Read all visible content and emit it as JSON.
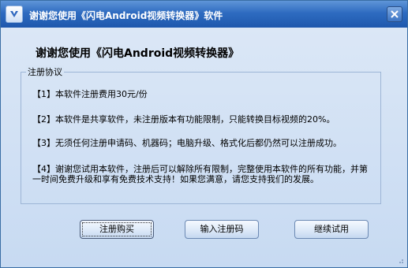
{
  "window": {
    "title": "谢谢您使用《闪电Android视频转换器》软件"
  },
  "dialog": {
    "heading": "谢谢您使用《闪电Android视频转换器》",
    "group_label": "注册协议",
    "terms": [
      "【1】本软件注册费用30元/份",
      "【2】本软件是共享软件，未注册版本有功能限制，只能转换目标视频的20%。",
      "【3】无须任何注册申请码、机器码；电脑升级、格式化后都仍然可以注册成功。",
      "【4】谢谢您试用本软件，注册后可以解除所有限制，完整使用本软件的所有功能，并第一时间免费升级和享有免费技术支持！如果您满意，请您支持我们的发展。"
    ]
  },
  "buttons": {
    "buy": "注册购买",
    "enter_code": "输入注册码",
    "continue_trial": "继续试用"
  },
  "icons": {
    "app": "app-logo-icon",
    "close": "close-icon"
  },
  "colors": {
    "titlebar": "#2e6bc0",
    "background": "#c9dcf3"
  }
}
